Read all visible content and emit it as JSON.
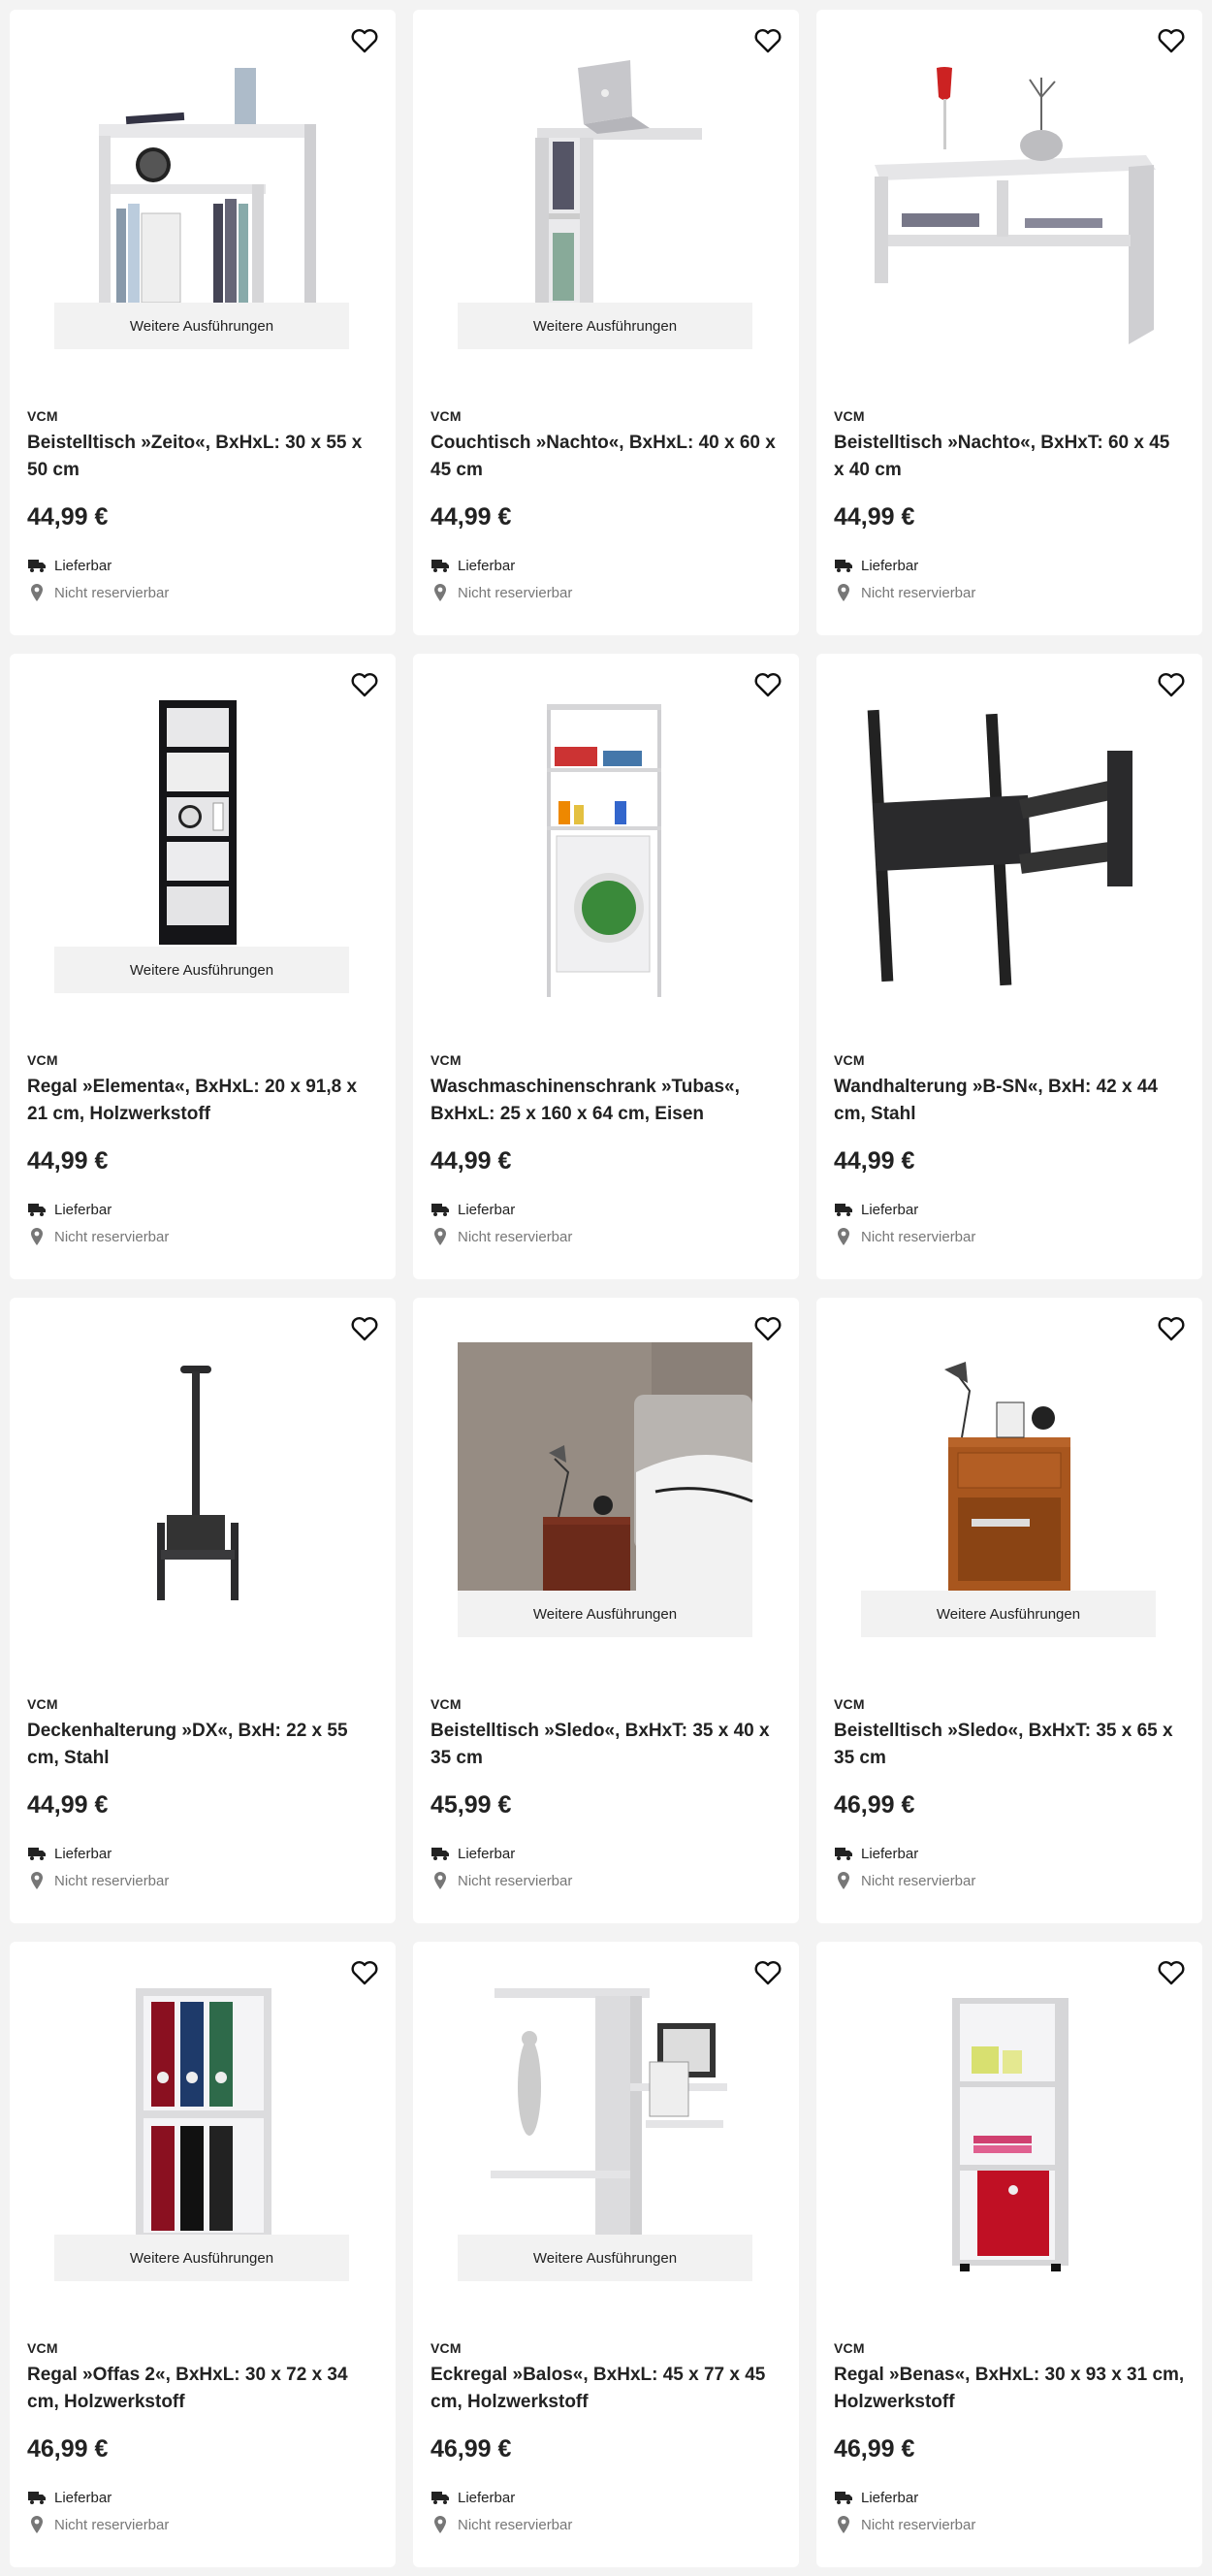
{
  "variants_label": "Weitere Ausführungen",
  "products": [
    {
      "brand": "VCM",
      "title": "Beistelltisch »Zeito«, BxHxL: 30 x 55 x 50 cm",
      "price": "44,99 €",
      "delivery": "Lieferbar",
      "store": "Nicht reservierbar",
      "has_variants": true
    },
    {
      "brand": "VCM",
      "title": "Couchtisch »Nachto«, BxHxL: 40 x 60 x 45 cm",
      "price": "44,99 €",
      "delivery": "Lieferbar",
      "store": "Nicht reservierbar",
      "has_variants": true
    },
    {
      "brand": "VCM",
      "title": "Beistelltisch »Nachto«, BxHxT: 60 x 45 x 40 cm",
      "price": "44,99 €",
      "delivery": "Lieferbar",
      "store": "Nicht reservierbar",
      "has_variants": false
    },
    {
      "brand": "VCM",
      "title": "Regal »Elementa«, BxHxL: 20 x 91,8 x 21 cm, Holzwerkstoff",
      "price": "44,99 €",
      "delivery": "Lieferbar",
      "store": "Nicht reservierbar",
      "has_variants": true
    },
    {
      "brand": "VCM",
      "title": "Waschmaschinenschrank »Tubas«, BxHxL: 25 x 160 x 64 cm, Eisen",
      "price": "44,99 €",
      "delivery": "Lieferbar",
      "store": "Nicht reservierbar",
      "has_variants": false
    },
    {
      "brand": "VCM",
      "title": "Wandhalterung »B-SN«, BxH: 42 x 44 cm, Stahl",
      "price": "44,99 €",
      "delivery": "Lieferbar",
      "store": "Nicht reservierbar",
      "has_variants": false
    },
    {
      "brand": "VCM",
      "title": "Deckenhalterung »DX«, BxH: 22 x 55 cm, Stahl",
      "price": "44,99 €",
      "delivery": "Lieferbar",
      "store": "Nicht reservierbar",
      "has_variants": false
    },
    {
      "brand": "VCM",
      "title": "Beistelltisch »Sledo«, BxHxT: 35 x 40 x 35 cm",
      "price": "45,99 €",
      "delivery": "Lieferbar",
      "store": "Nicht reservierbar",
      "has_variants": true
    },
    {
      "brand": "VCM",
      "title": "Beistelltisch »Sledo«, BxHxT: 35 x 65 x 35 cm",
      "price": "46,99 €",
      "delivery": "Lieferbar",
      "store": "Nicht reservierbar",
      "has_variants": true
    },
    {
      "brand": "VCM",
      "title": "Regal »Offas 2«, BxHxL: 30 x 72 x 34 cm, Holzwerkstoff",
      "price": "46,99 €",
      "delivery": "Lieferbar",
      "store": "Nicht reservierbar",
      "has_variants": true
    },
    {
      "brand": "VCM",
      "title": "Eckregal »Balos«, BxHxL: 45 x 77 x 45 cm, Holzwerkstoff",
      "price": "46,99 €",
      "delivery": "Lieferbar",
      "store": "Nicht reservierbar",
      "has_variants": true
    },
    {
      "brand": "VCM",
      "title": "Regal »Benas«, BxHxL: 30 x 93 x 31 cm, Holzwerkstoff",
      "price": "46,99 €",
      "delivery": "Lieferbar",
      "store": "Nicht reservierbar",
      "has_variants": false
    }
  ],
  "icons": {
    "favorite": "heart-outline-icon",
    "delivery": "truck-icon",
    "store": "location-pin-icon"
  }
}
